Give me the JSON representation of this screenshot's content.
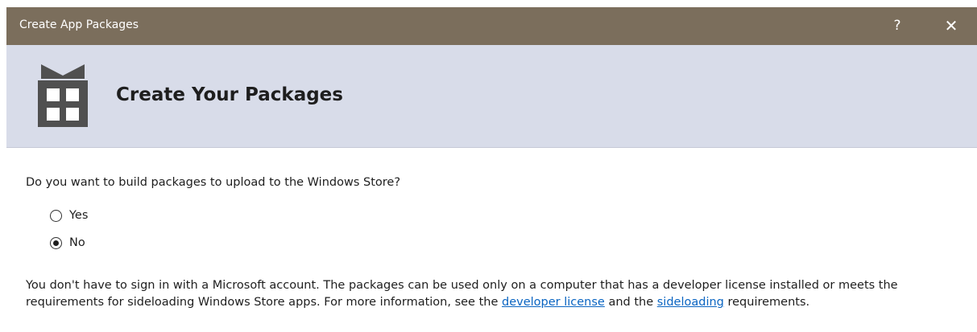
{
  "window": {
    "title": "Create App Packages",
    "help_label": "?",
    "close_label": "✕"
  },
  "header": {
    "title": "Create Your Packages",
    "icon": "gift-package-icon"
  },
  "question": {
    "text": "Do you want to build packages to upload to the Windows Store?"
  },
  "options": [
    {
      "label": "Yes",
      "selected": false
    },
    {
      "label": "No",
      "selected": true
    }
  ],
  "description": {
    "text_before": "You don't have to sign in with a Microsoft account. The packages can be used only on a computer that has a developer license installed or meets the requirements for sideloading Windows Store apps. For more information, see the ",
    "link1": "developer license",
    "text_between": " and the ",
    "link2": "sideloading",
    "text_after": " requirements."
  },
  "colors": {
    "titlebar": "#7b6e5c",
    "header_background": "#d8dce9",
    "link": "#0a65c2",
    "icon": "#505050"
  }
}
